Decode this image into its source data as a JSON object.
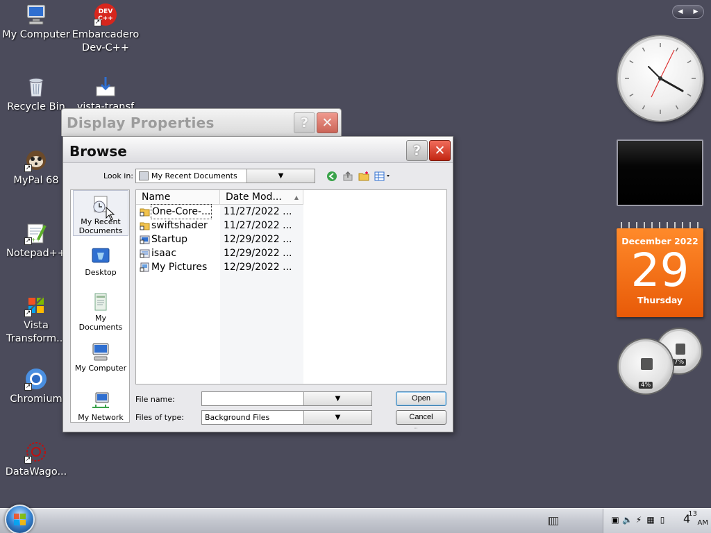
{
  "desktop": {
    "icons": [
      {
        "label": "My Computer"
      },
      {
        "label": "Embarcadero Dev-C++"
      },
      {
        "label": "Recycle Bin"
      },
      {
        "label": "vista-transf"
      },
      {
        "label": "MyPal 68"
      },
      {
        "label": "Notepad++"
      },
      {
        "label": "Vista Transform..."
      },
      {
        "label": "Chromium"
      },
      {
        "label": "DataWago..."
      }
    ],
    "devcpp_badge": "DEV C++"
  },
  "gadgets": {
    "nav_prev": "◀",
    "nav_next": "▶",
    "calendar": {
      "month": "December 2022",
      "day": "29",
      "weekday": "Thursday"
    },
    "cpu_meter": {
      "value": "4%"
    },
    "mem_meter": {
      "value": "7%"
    }
  },
  "display_properties": {
    "title": "Display Properties",
    "help": "?",
    "close": "✕"
  },
  "browse": {
    "title": "Browse",
    "help": "?",
    "close": "✕",
    "look_in_label": "Look in:",
    "look_in_value": "My Recent Documents",
    "places": [
      {
        "label": "My Recent Documents",
        "selected": true
      },
      {
        "label": "Desktop"
      },
      {
        "label": "My Documents"
      },
      {
        "label": "My Computer"
      },
      {
        "label": "My Network"
      }
    ],
    "columns": {
      "name": "Name",
      "date": "Date Mod..."
    },
    "files": [
      {
        "name": "One-Core-...",
        "date": "11/27/2022 ..."
      },
      {
        "name": "swiftshader",
        "date": "11/27/2022 ..."
      },
      {
        "name": "Startup",
        "date": "12/29/2022 ..."
      },
      {
        "name": "isaac",
        "date": "12/29/2022 ..."
      },
      {
        "name": "My Pictures",
        "date": "12/29/2022 ..."
      }
    ],
    "file_name_label": "File name:",
    "file_name_value": "",
    "files_of_type_label": "Files of type:",
    "files_of_type_value": "Background Files",
    "open_button": "Open",
    "cancel_button": "Cancel"
  },
  "taskbar": {
    "clock_hour": "4",
    "clock_minute": "13",
    "clock_ampm": "AM"
  },
  "colors": {
    "desktop": "#4b4b5b",
    "calendar_orange": "#f07516",
    "close_red": "#d43a24"
  }
}
